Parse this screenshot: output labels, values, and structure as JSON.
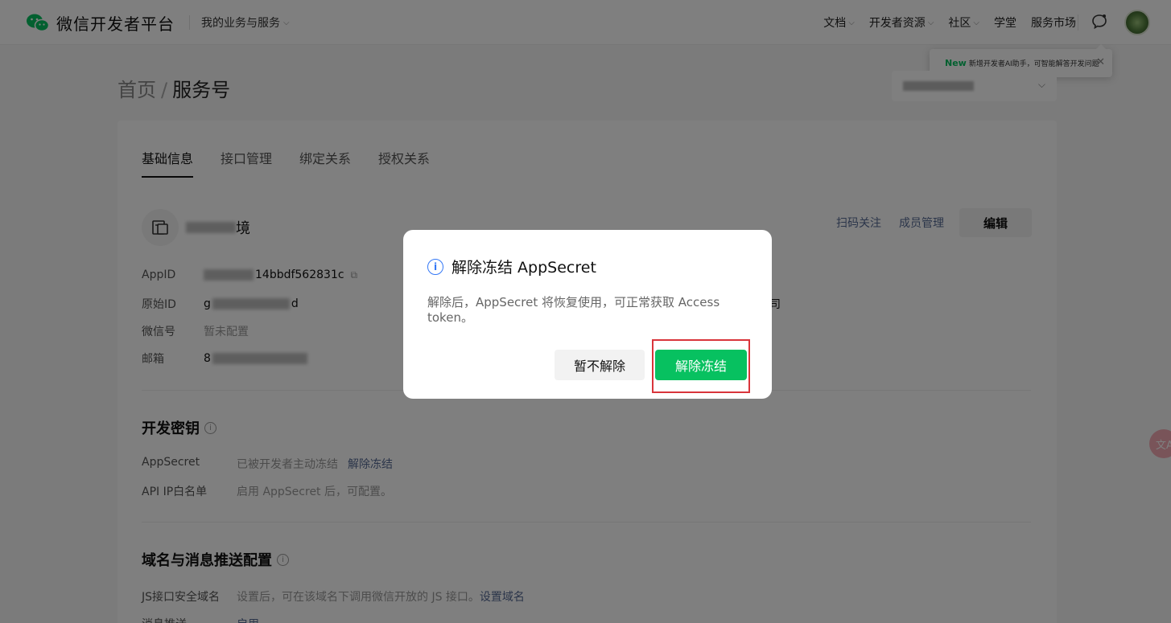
{
  "header": {
    "logo_text": "微信开发者平台",
    "biz_menu": "我的业务与服务",
    "nav": [
      {
        "label": "文档",
        "has_dropdown": true
      },
      {
        "label": "开发者资源",
        "has_dropdown": true
      },
      {
        "label": "社区",
        "has_dropdown": true
      },
      {
        "label": "学堂",
        "has_dropdown": false
      },
      {
        "label": "服务市场",
        "has_dropdown": false
      }
    ]
  },
  "tooltip": {
    "badge": "New",
    "text": "新增开发者AI助手，可智能解答开发问题"
  },
  "breadcrumb": {
    "home": "首页",
    "separator": "/",
    "current": "服务号"
  },
  "tabs": [
    "基础信息",
    "接口管理",
    "绑定关系",
    "授权关系"
  ],
  "account": {
    "name_suffix": "境",
    "links": [
      "扫码关注",
      "成员管理"
    ],
    "edit_label": "编辑",
    "fields": [
      {
        "label": "AppID",
        "value_prefix": "",
        "value_suffix": "14bbdf562831c"
      },
      {
        "label": "原始ID",
        "value_prefix": "g",
        "value_suffix": "d"
      },
      {
        "label": "微信号",
        "value_prefix": "",
        "value_suffix": "暂未配置"
      },
      {
        "label": "邮箱",
        "value_prefix": "8",
        "value_suffix": ""
      }
    ],
    "stray_text": "司"
  },
  "dev_keys": {
    "title": "开发密钥",
    "appsecret_label": "AppSecret",
    "appsecret_status": "已被开发者主动冻结",
    "appsecret_action": "解除冻结",
    "ip_label": "API IP白名单",
    "ip_status": "启用 AppSecret 后，可配置。"
  },
  "domain_cfg": {
    "title": "域名与消息推送配置",
    "js_label": "JS接口安全域名",
    "js_desc": "设置后，可在该域名下调用微信开放的 JS 接口。",
    "js_action": "设置域名",
    "push_label": "消息推送",
    "push_action": "启用"
  },
  "dialog": {
    "title": "解除冻结 AppSecret",
    "body": "解除后，AppSecret 将恢复使用，可正常获取 Access token。",
    "cancel_label": "暂不解除",
    "confirm_label": "解除冻结"
  },
  "float_widget_text": "文A",
  "colors": {
    "brand_green": "#07c160",
    "link_blue": "#576b95",
    "highlight_red": "#d9353b",
    "info_blue": "#3478f6"
  }
}
